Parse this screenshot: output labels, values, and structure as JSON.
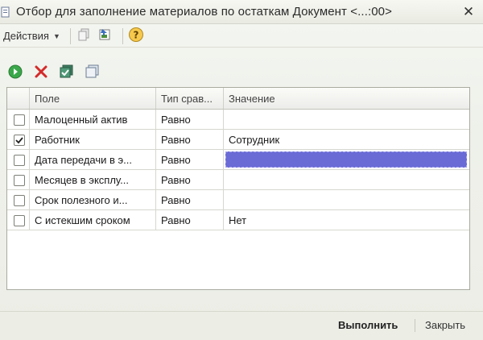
{
  "window": {
    "title": "Отбор для заполнение материалов по остаткам Документ <...:00>",
    "close_glyph": "✕"
  },
  "toolbar": {
    "actions_label": "Действия",
    "icons": [
      "copy-icon",
      "export-icon",
      "help-icon"
    ]
  },
  "inner_toolbar": {
    "icons": [
      "add-icon",
      "delete-icon",
      "check-all-icon",
      "uncheck-all-icon"
    ]
  },
  "grid": {
    "columns": [
      "Поле",
      "Тип срав...",
      "Значение"
    ],
    "rows": [
      {
        "checked": false,
        "field": "Малоценный актив",
        "comparison": "Равно",
        "value": "",
        "selected": false
      },
      {
        "checked": true,
        "field": "Работник",
        "comparison": "Равно",
        "value": "Сотрудник",
        "selected": false
      },
      {
        "checked": false,
        "field": "Дата передачи в э...",
        "comparison": "Равно",
        "value": "",
        "selected": true
      },
      {
        "checked": false,
        "field": "Месяцев в эксплу...",
        "comparison": "Равно",
        "value": "",
        "selected": false
      },
      {
        "checked": false,
        "field": "Срок полезного и...",
        "comparison": "Равно",
        "value": "",
        "selected": false
      },
      {
        "checked": false,
        "field": "С истекшим сроком",
        "comparison": "Равно",
        "value": "Нет",
        "selected": false
      }
    ]
  },
  "footer": {
    "run_label": "Выполнить",
    "close_label": "Закрыть"
  },
  "colors": {
    "selection": "#6b6bd6",
    "add_icon": "#3aa84a",
    "delete_icon": "#d42a2a"
  }
}
